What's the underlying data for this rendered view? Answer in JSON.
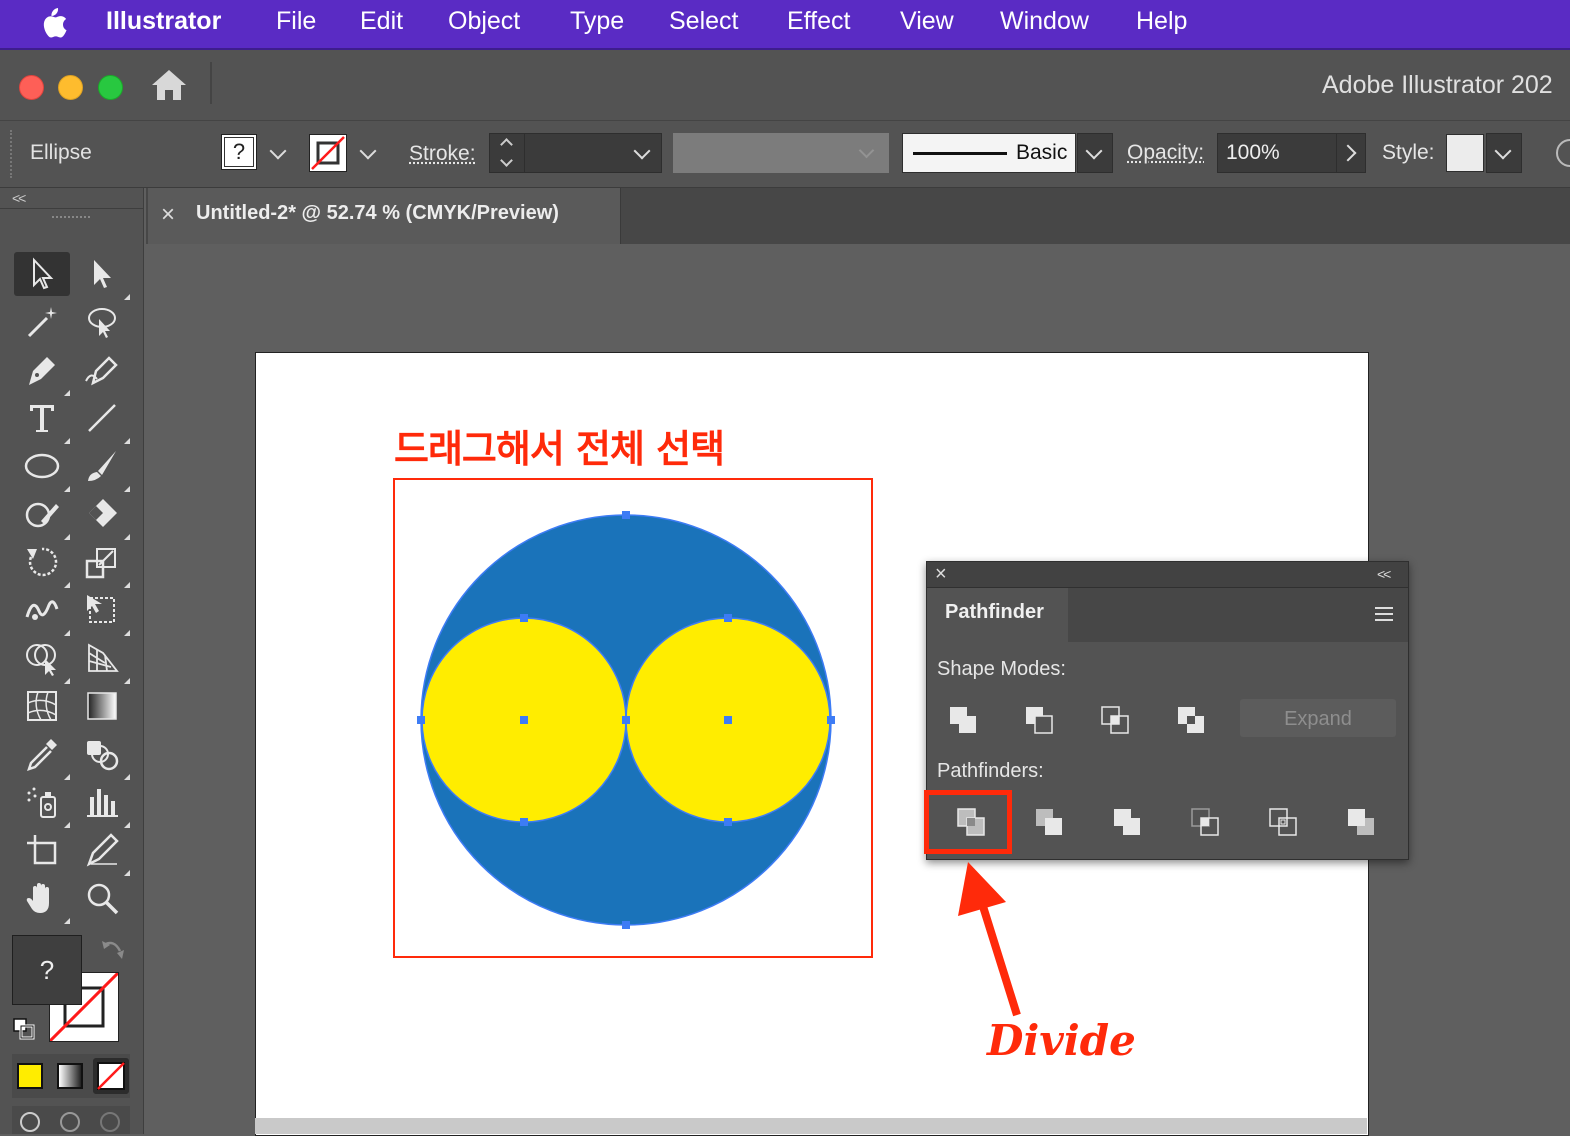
{
  "menubar": {
    "app_name": "Illustrator",
    "items": [
      "File",
      "Edit",
      "Object",
      "Type",
      "Select",
      "Effect",
      "View",
      "Window",
      "Help"
    ]
  },
  "window": {
    "title": "Adobe Illustrator 202"
  },
  "controlbar": {
    "selection_label": "Ellipse",
    "fill_value": "?",
    "stroke_label": "Stroke:",
    "stroke_profile": "Basic",
    "opacity_label": "Opacity:",
    "opacity_value": "100%",
    "style_label": "Style:"
  },
  "toolbar": {
    "collapse_glyph": "<<",
    "fill_swatch_text": "?"
  },
  "document": {
    "tab_title": "Untitled-2* @ 52.74 % (CMYK/Preview)",
    "close_glyph": "×"
  },
  "artwork": {
    "instruction_text": "드래그해서 전체 선택",
    "divide_callout": "Divide",
    "colors": {
      "big_circle": "#1a73ba",
      "small_circles": "#ffed00",
      "annotation": "#ff2a0a",
      "selection_handles": "#3d7cf5"
    }
  },
  "pathfinder_panel": {
    "tab_title": "Pathfinder",
    "close_glyph": "×",
    "collapse_glyph": "<<",
    "shape_modes_label": "Shape Modes:",
    "shape_modes": [
      "Unite",
      "Minus Front",
      "Intersect",
      "Exclude"
    ],
    "expand_label": "Expand",
    "pathfinders_label": "Pathfinders:",
    "pathfinders": [
      "Divide",
      "Trim",
      "Merge",
      "Crop",
      "Outline",
      "Minus Back"
    ]
  },
  "colors": {
    "menubar": "#5a2bc4",
    "ui_panel": "#535353",
    "canvas": "#5f5f5f"
  }
}
